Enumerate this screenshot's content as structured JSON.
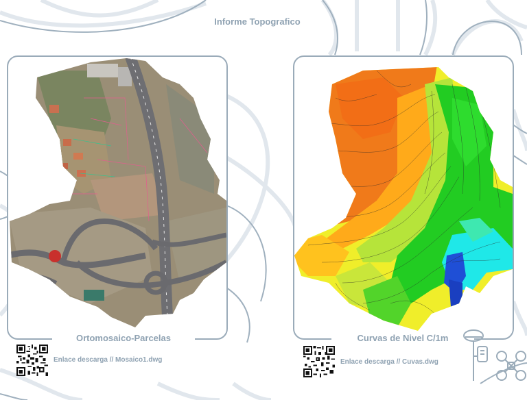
{
  "header": {
    "title": "Informe Topografico"
  },
  "panels": {
    "left": {
      "caption": "Ortomosaico-Parcelas",
      "download": "Enlace descarga // Mosaico1.dwg"
    },
    "right": {
      "caption": "Curvas de Nivel C/1m",
      "download": "Enlace descarga // Cuvas.dwg"
    }
  },
  "icons": [
    "qr-code-icon",
    "gps-survey-receiver-icon",
    "drone-icon"
  ],
  "colors": {
    "frame": "#9aabb9",
    "text": "#8fa2b2",
    "background_lines": "#dfe6ec",
    "elevation_ramp": [
      "#1f4fd6",
      "#1fe8e8",
      "#22cc22",
      "#8ee03a",
      "#f0ee2a",
      "#ffaa1a",
      "#f07a1a"
    ]
  }
}
